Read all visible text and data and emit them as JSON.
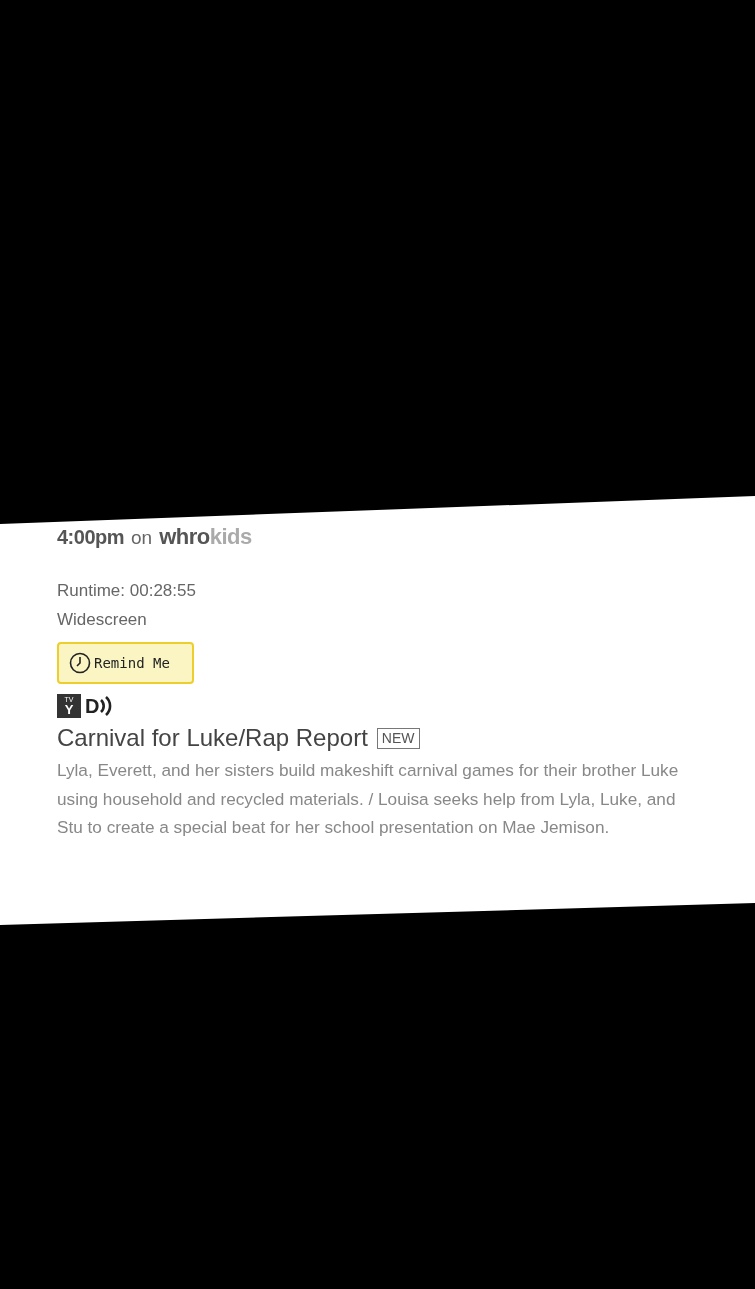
{
  "airing": {
    "time": "4:00pm",
    "on": "on",
    "channel_main": "whro",
    "channel_sub": "kids"
  },
  "details": [
    "Runtime: 00:28:55",
    "Widescreen"
  ],
  "remind_button": {
    "label": "Remind Me"
  },
  "rating": {
    "tv": "TV",
    "age": "Y"
  },
  "audio_description": "D",
  "episode": {
    "title": "Carnival for Luke/Rap Report",
    "badge": "NEW",
    "description": "Lyla, Everett, and her sisters build makeshift carnival games for their brother Luke using household and recycled materials. / Louisa seeks help from Lyla, Luke, and Stu to create a special beat for her school presentation on Mae Jemison."
  }
}
